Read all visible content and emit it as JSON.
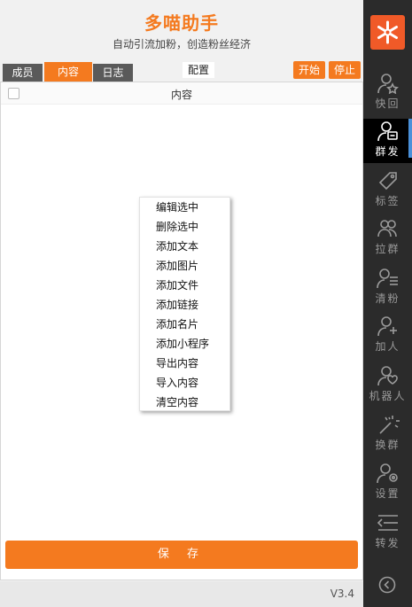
{
  "header": {
    "title": "多喵助手",
    "subtitle": "自动引流加粉，创造粉丝经济"
  },
  "tabs": [
    {
      "label": "成员",
      "active": false
    },
    {
      "label": "内容",
      "active": true
    },
    {
      "label": "日志",
      "active": false
    }
  ],
  "toolbar": {
    "config_label": "配置",
    "start_label": "开始",
    "stop_label": "停止"
  },
  "table": {
    "column_header": "内容"
  },
  "context_menu": {
    "items": [
      "编辑选中",
      "删除选中",
      "添加文本",
      "添加图片",
      "添加文件",
      "添加链接",
      "添加名片",
      "添加小程序",
      "导出内容",
      "导入内容",
      "清空内容"
    ]
  },
  "save_label": "保 存",
  "footer": {
    "version": "V3.4"
  },
  "sidebar": {
    "items": [
      {
        "label": "快回",
        "icon": "user-star-icon",
        "active": false
      },
      {
        "label": "群发",
        "icon": "user-message-icon",
        "active": true
      },
      {
        "label": "标签",
        "icon": "tag-icon",
        "active": false
      },
      {
        "label": "拉群",
        "icon": "group-icon",
        "active": false
      },
      {
        "label": "清粉",
        "icon": "user-list-icon",
        "active": false
      },
      {
        "label": "加人",
        "icon": "user-add-icon",
        "active": false
      },
      {
        "label": "机器人",
        "icon": "user-heart-icon",
        "active": false
      },
      {
        "label": "换群",
        "icon": "magic-wand-icon",
        "active": false
      },
      {
        "label": "设置",
        "icon": "user-settings-icon",
        "active": false
      },
      {
        "label": "转发",
        "icon": "forward-list-icon",
        "active": false
      }
    ]
  },
  "colors": {
    "accent": "#f47a1f",
    "sidebar_bg": "#2b2b2b",
    "logo_bg": "#f05a28"
  }
}
